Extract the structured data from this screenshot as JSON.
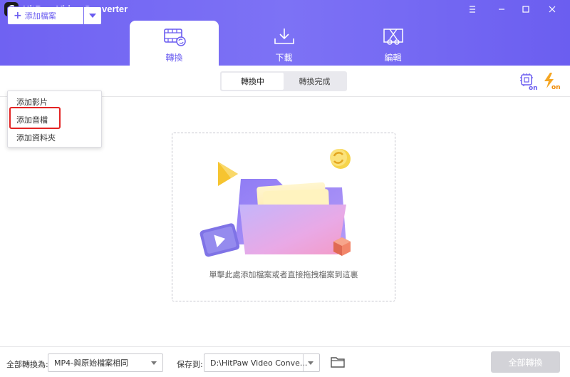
{
  "app": {
    "title": "HitPaw Video Converter",
    "logo_letter": "C"
  },
  "main_tabs": [
    {
      "label": "轉換",
      "icon": "film-convert-icon",
      "active": true
    },
    {
      "label": "下載",
      "icon": "download-tray-icon",
      "active": false
    },
    {
      "label": "編輯",
      "icon": "edit-scissors-icon",
      "active": false
    }
  ],
  "toolbar": {
    "add_files_label": "添加檔案",
    "segments": [
      "轉換中",
      "轉換完成"
    ],
    "hw_accel_label": "on",
    "fast_convert_label": "on"
  },
  "add_menu": {
    "items": [
      "添加影片",
      "添加音檔",
      "添加資料夾"
    ],
    "highlighted_index": 1
  },
  "dropzone": {
    "hint": "單擊此處添加檔案或者直接拖拽檔案到這裏"
  },
  "bottom": {
    "convert_all_to_label": "全部轉換為:",
    "format_value": "MP4-與原始檔案相同",
    "save_to_label": "保存到:",
    "save_path": "D:\\HitPaw Video Conve...",
    "convert_all_button": "全部轉換"
  },
  "colors": {
    "accent": "#6a5cf0",
    "header": "#7468f3",
    "highlight": "#e32424",
    "orange": "#f5a623"
  }
}
